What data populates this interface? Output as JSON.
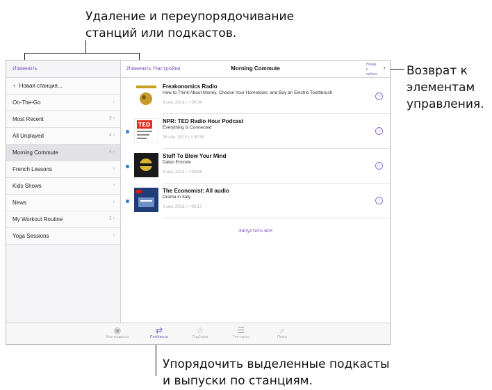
{
  "callouts": {
    "top": [
      "Удаление и переупорядочивание",
      "станций или подкастов."
    ],
    "right": [
      "Возврат к",
      "элементам",
      "управления."
    ],
    "bottom": [
      "Упорядочить выделенные подкасты",
      "и выпуски по станциям."
    ]
  },
  "sidebar": {
    "edit_label": "Изменить",
    "new_station": "Новая станция...",
    "items": [
      {
        "label": "On-The-Go",
        "meta": "›"
      },
      {
        "label": "Most Recent",
        "meta": "3 ›"
      },
      {
        "label": "All Unplayed",
        "meta": "4 ›"
      },
      {
        "label": "Morning Commute",
        "meta": "4 ›"
      },
      {
        "label": "French Lessons",
        "meta": "›"
      },
      {
        "label": "Kids Shows",
        "meta": "›"
      },
      {
        "label": "News",
        "meta": "›"
      },
      {
        "label": "My Workout Routine",
        "meta": "2 ›"
      },
      {
        "label": "Yoga Sessions",
        "meta": "›"
      }
    ]
  },
  "main": {
    "edit_settings": "Изменить Настройки",
    "title": "Morning Commute",
    "back_label": "Назад к сейчас",
    "episodes": [
      {
        "title": "Freakonomics Radio",
        "subtitle": "How to Think About Money, Choose Your Hometown, and Buy an Electric Toothbrush",
        "date": "9 сен. 2013 г. • 00:34",
        "unplayed": false
      },
      {
        "title": "NPR: TED Radio Hour Podcast",
        "subtitle": "Everything is Connected",
        "date": "26 сен. 2013 г. • 00:50",
        "unplayed": true
      },
      {
        "title": "Stuff To Blow Your Mind",
        "subtitle": "Daleo Encode",
        "date": "3 сен. 2013 г. • 00:58",
        "unplayed": true
      },
      {
        "title": "The Economist: All audio",
        "subtitle": "Drama in Italy",
        "date": "3 сен. 2013 г. • 00:17",
        "unplayed": true
      }
    ],
    "play_all": "Запустить все"
  },
  "tabbar": {
    "tabs": [
      {
        "label": "Мои подкасты",
        "icon": "podcast-icon"
      },
      {
        "label": "Плейлисты",
        "icon": "playlist-icon"
      },
      {
        "label": "Подборка",
        "icon": "star-icon"
      },
      {
        "label": "Топ-чарты",
        "icon": "list-icon"
      },
      {
        "label": "Поиск",
        "icon": "search-icon"
      }
    ],
    "active_index": 1
  },
  "colors": {
    "accent": "#7c5bbf",
    "unplayed_dot": "#2b7be0"
  }
}
